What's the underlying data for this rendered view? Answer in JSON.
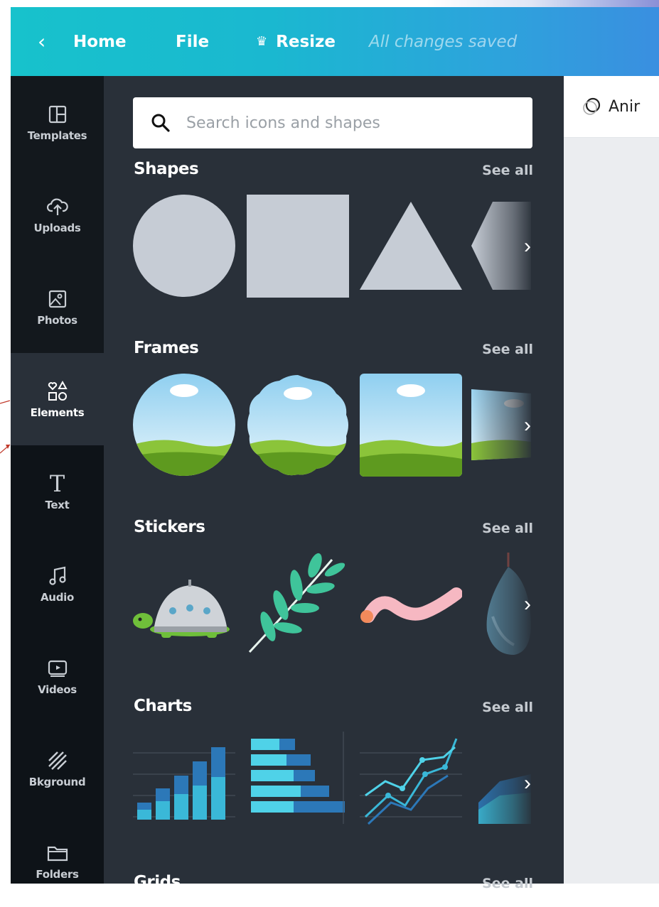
{
  "topbar": {
    "back_icon": "chevron-left-icon",
    "home": "Home",
    "file": "File",
    "resize_icon": "crown-icon",
    "resize": "Resize",
    "status": "All changes saved"
  },
  "editor": {
    "animate": "Anir"
  },
  "sidebar": {
    "items": [
      {
        "label": "Templates",
        "icon": "templates-icon"
      },
      {
        "label": "Uploads",
        "icon": "upload-cloud-icon"
      },
      {
        "label": "Photos",
        "icon": "photos-icon"
      },
      {
        "label": "Elements",
        "icon": "elements-icon",
        "active": true
      },
      {
        "label": "Text",
        "icon": "text-icon"
      },
      {
        "label": "Audio",
        "icon": "music-note-icon"
      },
      {
        "label": "Videos",
        "icon": "video-icon"
      },
      {
        "label": "Bkground",
        "icon": "background-icon"
      },
      {
        "label": "Folders",
        "icon": "folder-icon"
      }
    ]
  },
  "panel": {
    "search_placeholder": "Search icons and shapes",
    "sections": [
      {
        "title": "Shapes",
        "see_all": "See all"
      },
      {
        "title": "Frames",
        "see_all": "See all"
      },
      {
        "title": "Stickers",
        "see_all": "See all"
      },
      {
        "title": "Charts",
        "see_all": "See all"
      },
      {
        "title": "Grids",
        "see_all": "See all"
      }
    ]
  },
  "colors": {
    "topbar_start": "#17c2cc",
    "topbar_end": "#3a8fe0",
    "sidebar": "#0e1318",
    "panel": "#293039",
    "shape_fill": "#c6ccd5"
  }
}
